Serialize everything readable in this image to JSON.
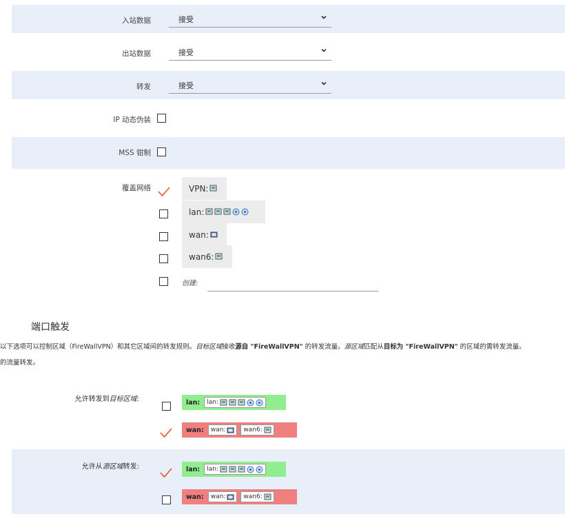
{
  "fields": {
    "inbound": {
      "label": "入站数据",
      "value": "接受"
    },
    "outbound": {
      "label": "出站数据",
      "value": "接受"
    },
    "forward": {
      "label": "转发",
      "value": "接受"
    },
    "masq": {
      "label": "IP 动态伪装"
    },
    "mss": {
      "label": "MSS 钳制"
    },
    "covered": {
      "label": "覆盖网络"
    }
  },
  "networks": [
    {
      "name": "VPN:",
      "checked": true
    },
    {
      "name": "lan:",
      "checked": false
    },
    {
      "name": "wan:",
      "checked": false
    },
    {
      "name": "wan6:",
      "checked": false
    }
  ],
  "create_label": "创建:",
  "section_title": "端口触发",
  "description": {
    "p1": "以下选项可以控制区域（FireWallVPN）和其它区域间的转发规则。",
    "dest_zone": "目标区域",
    "p2": "接收",
    "src_bold": "源自 \"FireWallVPN\"",
    "p3": " 的转发流量。",
    "src_zone": "源区域",
    "p4": "匹配从",
    "dst_bold": "目标为 \"FireWallVPN\"",
    "p5": " 的区域的需转发流量。",
    "line2": "的流量转发。"
  },
  "allow_to": {
    "label_prefix": "允许转发到",
    "label_em": "目标区域",
    "label_suffix": ":"
  },
  "allow_from": {
    "label_prefix": "允许从",
    "label_em": "源区域",
    "label_suffix": "转发:"
  },
  "zones": {
    "lan": {
      "tag": "lan:",
      "chip": "lan:",
      "color": "#90ee90"
    },
    "wan": {
      "tag": "wan:",
      "chip1": "wan:",
      "chip2": "wan6:",
      "color": "#f08080"
    }
  },
  "colors": {
    "shade": "#e9eff9",
    "check": "#e8542a"
  }
}
